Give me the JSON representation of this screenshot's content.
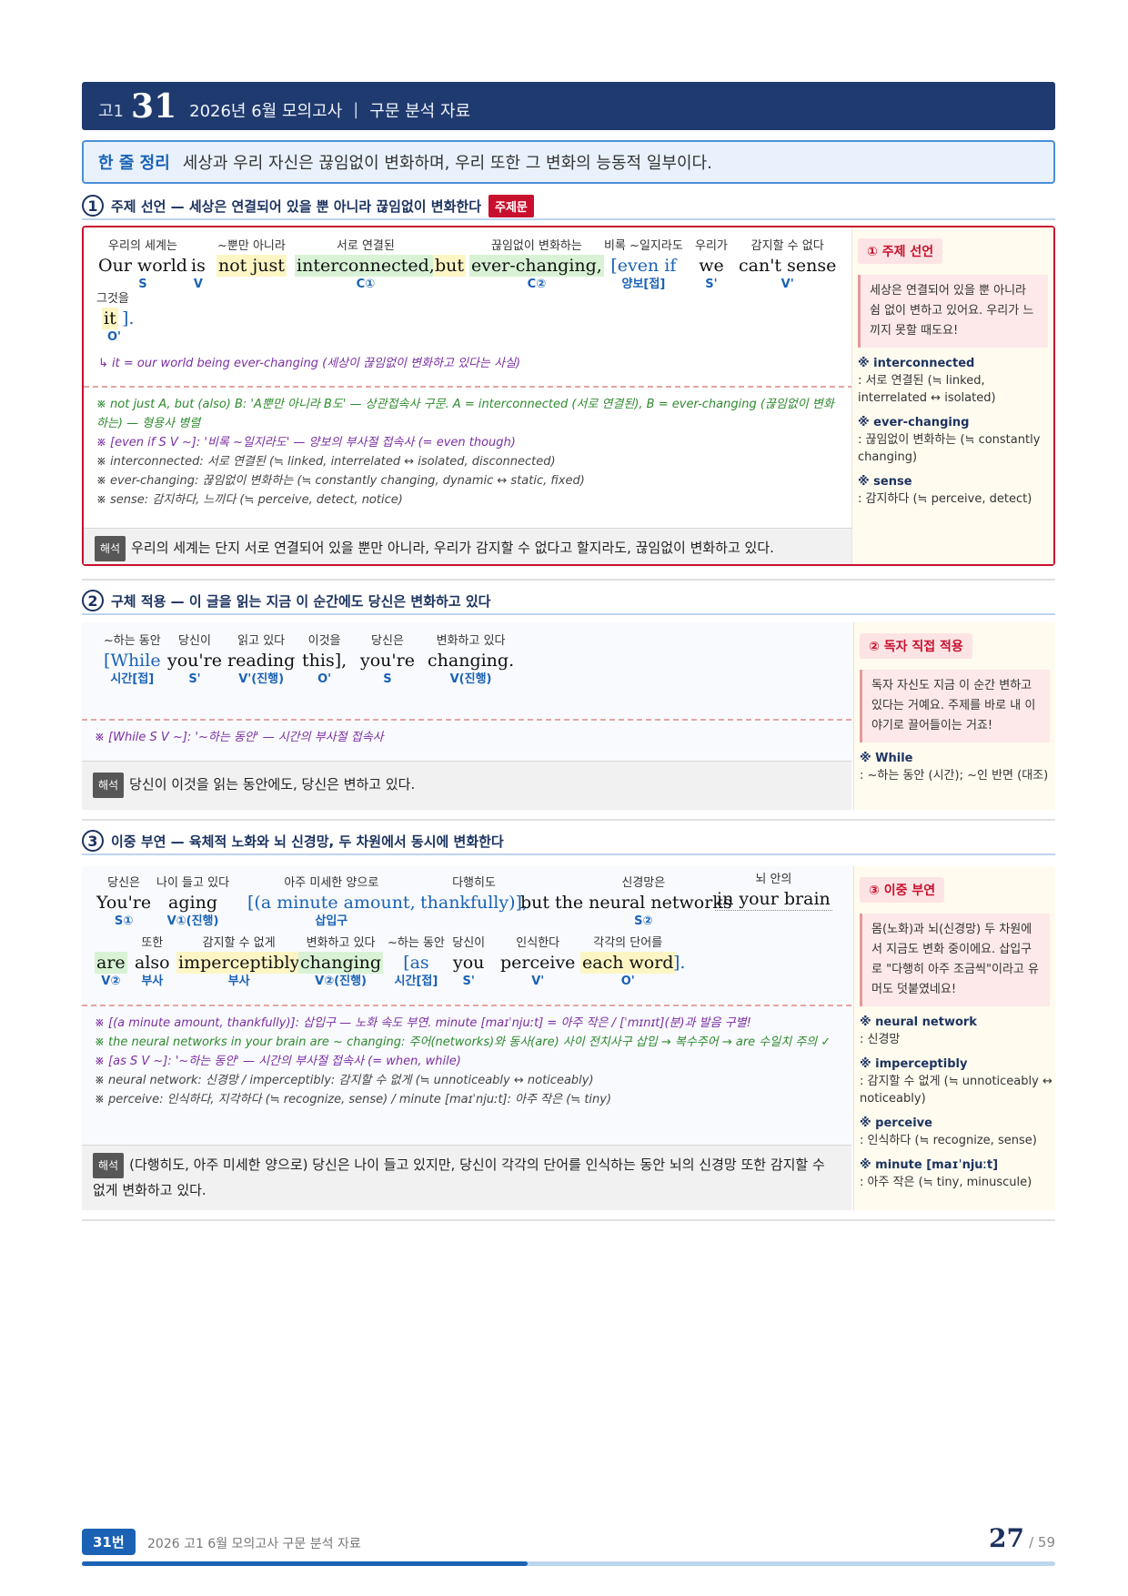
{
  "header": {
    "grade": "고1",
    "number": "31",
    "title": "2026년 6월 모의고사",
    "sep": "|",
    "subtitle": "구문 분석 자료"
  },
  "summary": {
    "label": "한 줄 정리",
    "text": "세상과 우리 자신은 끊임없이 변화하며, 우리 또한 그 변화의 능동적 일부이다."
  },
  "sections": [
    {
      "num": "1",
      "heading": "주제 선언 — 세상은 연결되어 있을 뿐 아니라 끊임없이 변화한다",
      "tag": "주제문",
      "chunks": [
        {
          "gloss": "우리의 세계는",
          "en": "Our world",
          "role": "S"
        },
        {
          "gloss": "",
          "en": "is",
          "role": "V"
        },
        {
          "gloss": "~뿐만 아니라",
          "en": "not just",
          "role": ""
        },
        {
          "gloss": "서로 연결된",
          "en": "interconnected,",
          "role": "C①"
        },
        {
          "gloss": "",
          "en": "but",
          "role": ""
        },
        {
          "gloss": "끊임없이 변화하는",
          "en": "ever-changing,",
          "role": "C②"
        },
        {
          "gloss": "비록 ~일지라도",
          "en": "[even if",
          "role": "양보[접]"
        },
        {
          "gloss": "우리가",
          "en": "we",
          "role": "S'"
        },
        {
          "gloss": "감지할 수 없다",
          "en": "can't sense",
          "role": "V'"
        },
        {
          "gloss": "그것을",
          "en": "it",
          "role": "O'"
        },
        {
          "gloss": "",
          "en": "].",
          "role": ""
        }
      ],
      "ref": "↳ it = our world being ever-changing (세상이 끊임없이 변화하고 있다는 사실)",
      "notes": [
        {
          "color": "green",
          "text": "※ not just A, but (also) B: 'A뿐만 아니라 B도' — 상관접속사 구문. A = interconnected (서로 연결된), B = ever-changing (끊임없이 변화하는) — 형용사 병렬"
        },
        {
          "color": "purple",
          "text": "※ [even if S V ~]: '비록 ~일지라도' — 양보의 부사절 접속사 (= even though)"
        },
        {
          "color": "gray",
          "text": "※ interconnected: 서로 연결된 (≒ linked, interrelated ↔ isolated, disconnected)"
        },
        {
          "color": "gray",
          "text": "※ ever-changing: 끊임없이 변화하는 (≒ constantly changing, dynamic ↔ static, fixed)"
        },
        {
          "color": "gray",
          "text": "※ sense: 감지하다, 느끼다 (≒ perceive, detect, notice)"
        }
      ],
      "translation_tag": "해석",
      "translation": "우리의 세계는 단지 서로 연결되어 있을 뿐만 아니라, 우리가 감지할 수 없다고 할지라도, 끊임없이 변화하고 있다.",
      "side": {
        "pill": "① 주제 선언",
        "box": "세상은 연결되어 있을 뿐 아니라 쉼 없이 변하고 있어요. 우리가 느끼지 못할 때도요!",
        "vocab": [
          {
            "head": "※ interconnected",
            "body": ": 서로 연결된 (≒ linked, interrelated ↔ isolated)"
          },
          {
            "head": "※ ever-changing",
            "body": ": 끊임없이 변화하는 (≒ constantly changing)"
          },
          {
            "head": "※ sense",
            "body": ": 감지하다 (≒ perceive, detect)"
          }
        ]
      }
    },
    {
      "num": "2",
      "heading": "구체 적용 — 이 글을 읽는 지금 이 순간에도 당신은 변화하고 있다",
      "chunks": [
        {
          "gloss": "~하는 동안",
          "en": "[While",
          "role": "시간[접]"
        },
        {
          "gloss": "당신이",
          "en": "you're",
          "role": "S'"
        },
        {
          "gloss": "읽고 있다",
          "en": "reading",
          "role": "V'(진행)"
        },
        {
          "gloss": "이것을",
          "en": "this],",
          "role": "O'"
        },
        {
          "gloss": "당신은",
          "en": "you're",
          "role": "S"
        },
        {
          "gloss": "변화하고 있다",
          "en": "changing.",
          "role": "V(진행)"
        }
      ],
      "notes": [
        {
          "color": "purple",
          "text": "※ [While S V ~]: '~하는 동안' — 시간의 부사절 접속사"
        }
      ],
      "translation_tag": "해석",
      "translation": "당신이 이것을 읽는 동안에도, 당신은 변하고 있다.",
      "side": {
        "pill": "② 독자 직접 적용",
        "box": "독자 자신도 지금 이 순간 변하고 있다는 거예요. 주제를 바로 내 이야기로 끌어들이는 거죠!",
        "vocab": [
          {
            "head": "※ While",
            "body": ": ~하는 동안 (시간); ~인 반면 (대조)"
          }
        ]
      }
    },
    {
      "num": "3",
      "heading": "이중 부연 — 육체적 노화와 뇌 신경망, 두 차원에서 동시에 변화한다",
      "chunks": [
        {
          "gloss": "당신은",
          "en": "You're",
          "role": "S①"
        },
        {
          "gloss": "나이 들고 있다",
          "en": "aging",
          "role": "V①(진행)"
        },
        {
          "gloss": "아주 미세한 양으로",
          "en": "[(a minute amount,",
          "role": "삽입구"
        },
        {
          "gloss": "다행히도",
          "en": "thankfully)],",
          "role": ""
        },
        {
          "gloss": "",
          "en": "but",
          "role": ""
        },
        {
          "gloss": "신경망은",
          "en": "the neural networks",
          "role": "S②"
        },
        {
          "gloss": "뇌 안의",
          "en": "in your brain",
          "role": ""
        },
        {
          "gloss": "",
          "en": "are",
          "role": "V②"
        },
        {
          "gloss": "또한",
          "en": "also",
          "role": "부사"
        },
        {
          "gloss": "감지할 수 없게",
          "en": "imperceptibly",
          "role": "부사"
        },
        {
          "gloss": "변화하고 있다",
          "en": "changing",
          "role": "V②(진행)"
        },
        {
          "gloss": "~하는 동안",
          "en": "[as",
          "role": "시간[접]"
        },
        {
          "gloss": "당신이",
          "en": "you",
          "role": "S'"
        },
        {
          "gloss": "인식한다",
          "en": "perceive",
          "role": "V'"
        },
        {
          "gloss": "각각의 단어를",
          "en": "each word",
          "role": "O'"
        },
        {
          "gloss": "",
          "en": "].",
          "role": ""
        }
      ],
      "notes": [
        {
          "color": "purple",
          "text": "※ [(a minute amount, thankfully)]: 삽입구 — 노화 속도 부연. minute [maɪˈnjuːt] = 아주 작은 / [ˈmɪnɪt](분)과 발음 구별!"
        },
        {
          "color": "green",
          "text": "※ the neural networks in your brain are ~ changing: 주어(networks)와 동사(are) 사이 전치사구 삽입 → 복수주어 → are 수일치 주의 ✓"
        },
        {
          "color": "purple",
          "text": "※ [as S V ~]: '~하는 동안' — 시간의 부사절 접속사 (= when, while)"
        },
        {
          "color": "gray",
          "text": "※ neural network: 신경망 / imperceptibly: 감지할 수 없게 (≒ unnoticeably ↔ noticeably)"
        },
        {
          "color": "gray",
          "text": "※ perceive: 인식하다, 지각하다 (≒ recognize, sense) / minute [maɪˈnjuːt]: 아주 작은 (≒ tiny)"
        }
      ],
      "translation_tag": "해석",
      "translation": "(다행히도, 아주 미세한 양으로) 당신은 나이 들고 있지만, 당신이 각각의 단어를 인식하는 동안 뇌의 신경망 또한 감지할 수 없게 변화하고 있다.",
      "side": {
        "pill": "③ 이중 부연",
        "box": "몸(노화)과 뇌(신경망) 두 차원에서 지금도 변화 중이에요. 삽입구로 \"다행히 아주 조금씩\"이라고 유머도 덧붙였네요!",
        "vocab": [
          {
            "head": "※ neural network",
            "body": ": 신경망"
          },
          {
            "head": "※ imperceptibly",
            "body": ": 감지할 수 없게 (≒ unnoticeably ↔ noticeably)"
          },
          {
            "head": "※ perceive",
            "body": ": 인식하다 (≒ recognize, sense)"
          },
          {
            "head": "※ minute [maɪˈnjuːt]",
            "body": ": 아주 작은 (≒ tiny, minuscule)"
          }
        ]
      }
    }
  ],
  "footer": {
    "badge": "31번",
    "text": "2026 고1 6월 모의고사 구문 분석 자료",
    "page": "27",
    "total": "/ 59",
    "progress": 0.4576
  },
  "colors": {
    "navy": "#1f3a6e",
    "accent": "#1b62b5",
    "red": "#c8102e"
  }
}
